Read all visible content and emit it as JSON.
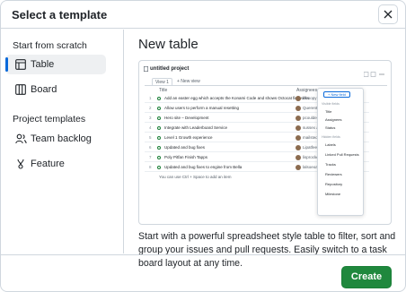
{
  "dialog": {
    "title": "Select a template",
    "close_icon": "close-icon"
  },
  "sidebar": {
    "scratch_label": "Start from scratch",
    "scratch_items": [
      {
        "label": "Table",
        "icon": "table-icon",
        "active": true
      },
      {
        "label": "Board",
        "icon": "board-icon",
        "active": false
      }
    ],
    "templates_label": "Project templates",
    "template_items": [
      {
        "label": "Team backlog",
        "icon": "people-icon"
      },
      {
        "label": "Feature",
        "icon": "feature-icon"
      }
    ]
  },
  "main": {
    "title": "New table",
    "description": "Start with a powerful spreadsheet style table to filter, sort and group your issues and pull requests. Easily switch to a task board layout at any time.",
    "preview": {
      "project_title": "untitled project",
      "view_tab": "View 1",
      "new_view": "+ New view",
      "col_title": "Title",
      "col_assignees": "Assignees",
      "rows": [
        {
          "n": "1",
          "text": "Add an easter egg which accepts the Konami Code and shows Octocat fireworks",
          "who": "lifeoopy and others"
        },
        {
          "n": "2",
          "text": "Allow users to perform a manual resetting",
          "who": "Querentcats and ..."
        },
        {
          "n": "3",
          "text": "Hero site – Development",
          "who": "pcoulded"
        },
        {
          "n": "4",
          "text": "Integrate with Leaderboard Service",
          "who": "sussex and jeans"
        },
        {
          "n": "5",
          "text": "Level 1 Growth experience",
          "who": "mailsted"
        },
        {
          "n": "6",
          "text": "Updated and bug fixes",
          "who": "Lipatfeek and jeans"
        },
        {
          "n": "7",
          "text": "Poly Pitfan Finish Tapps",
          "who": "lisprockes"
        },
        {
          "n": "8",
          "text": "Updated and bug fixes to engine from Bella",
          "who": "lalsoeoam"
        }
      ],
      "add_item": "You can use  Ctrl + Space  to add an item",
      "menu": {
        "new_field": "+ New field",
        "visible_header": "Visible fields",
        "visible": [
          "Title",
          "Assignees",
          "Status"
        ],
        "hidden_header": "Hidden fields",
        "hidden": [
          "Labels",
          "Linked Pull Requests",
          "Tracks",
          "Reviewers",
          "Repository",
          "Milestone"
        ]
      }
    }
  },
  "footer": {
    "create_label": "Create"
  },
  "colors": {
    "accent": "#0969da",
    "create": "#1f883d",
    "border": "#d0d7de"
  }
}
